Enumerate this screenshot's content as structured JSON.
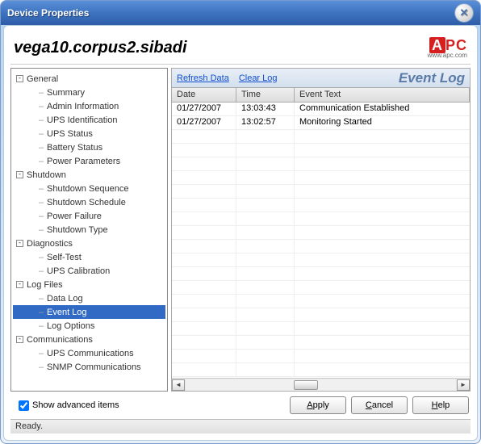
{
  "window": {
    "title": "Device Properties"
  },
  "header": {
    "device_name": "vega10.corpus2.sibadi",
    "logo_left": "A",
    "logo_right": "PC",
    "logo_url": "www.apc.com"
  },
  "tree": {
    "sections": [
      {
        "label": "General",
        "children": [
          "Summary",
          "Admin Information",
          "UPS Identification",
          "UPS Status",
          "Battery Status",
          "Power Parameters"
        ]
      },
      {
        "label": "Shutdown",
        "children": [
          "Shutdown Sequence",
          "Shutdown Schedule",
          "Power Failure",
          "Shutdown Type"
        ]
      },
      {
        "label": "Diagnostics",
        "children": [
          "Self-Test",
          "UPS Calibration"
        ]
      },
      {
        "label": "Log Files",
        "children": [
          "Data Log",
          "Event Log",
          "Log Options"
        ]
      },
      {
        "label": "Communications",
        "children": [
          "UPS Communications",
          "SNMP Communications"
        ]
      }
    ],
    "selected": "Event Log"
  },
  "panel": {
    "refresh": "Refresh Data",
    "clear": "Clear Log",
    "title": "Event Log",
    "columns": {
      "date": "Date",
      "time": "Time",
      "event": "Event Text"
    },
    "rows": [
      {
        "date": "01/27/2007",
        "time": "13:03:43",
        "event": "Communication Established"
      },
      {
        "date": "01/27/2007",
        "time": "13:02:57",
        "event": "Monitoring Started"
      }
    ]
  },
  "footer": {
    "show_advanced": "Show advanced items",
    "apply": "Apply",
    "cancel": "Cancel",
    "help": "Help",
    "status": "Ready."
  }
}
